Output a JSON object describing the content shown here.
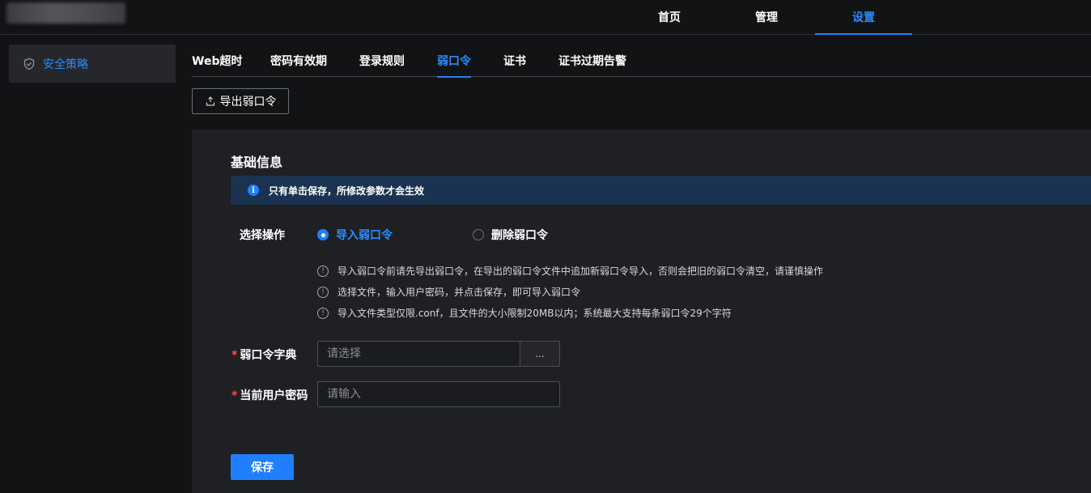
{
  "topnav": {
    "items": [
      {
        "label": "首页"
      },
      {
        "label": "管理"
      },
      {
        "label": "设置"
      }
    ],
    "active_index": 2
  },
  "sidebar": {
    "items": [
      {
        "label": "安全策略",
        "icon": "shield-icon"
      }
    ]
  },
  "tabs": {
    "items": [
      {
        "label": "Web超时"
      },
      {
        "label": "密码有效期"
      },
      {
        "label": "登录规则"
      },
      {
        "label": "弱口令"
      },
      {
        "label": "证书"
      },
      {
        "label": "证书过期告警"
      }
    ],
    "active_index": 3
  },
  "toolbar": {
    "export_label": "导出弱口令",
    "export_icon": "export-icon"
  },
  "panel": {
    "section_title": "基础信息",
    "notice": "只有单击保存，所修改参数才会生效",
    "operation": {
      "label": "选择操作",
      "options": [
        {
          "label": "导入弱口令",
          "checked": true
        },
        {
          "label": "删除弱口令",
          "checked": false
        }
      ]
    },
    "tips": [
      "导入弱口令前请先导出弱口令，在导出的弱口令文件中追加新弱口令导入，否则会把旧的弱口令清空，请谨慎操作",
      "选择文件，输入用户密码，并点击保存，即可导入弱口令",
      "导入文件类型仅限.conf，且文件的大小限制20MB以内；系统最大支持每条弱口令29个字符"
    ],
    "dictionary": {
      "required_mark": "*",
      "label": "弱口令字典",
      "placeholder": "请选择",
      "browse_label": "..."
    },
    "password": {
      "required_mark": "*",
      "label": "当前用户密码",
      "placeholder": "请输入"
    },
    "save_label": "保存"
  },
  "colors": {
    "accent": "#1f7fff",
    "notice_bg": "#1a3350",
    "required": "#ff4d4f"
  }
}
